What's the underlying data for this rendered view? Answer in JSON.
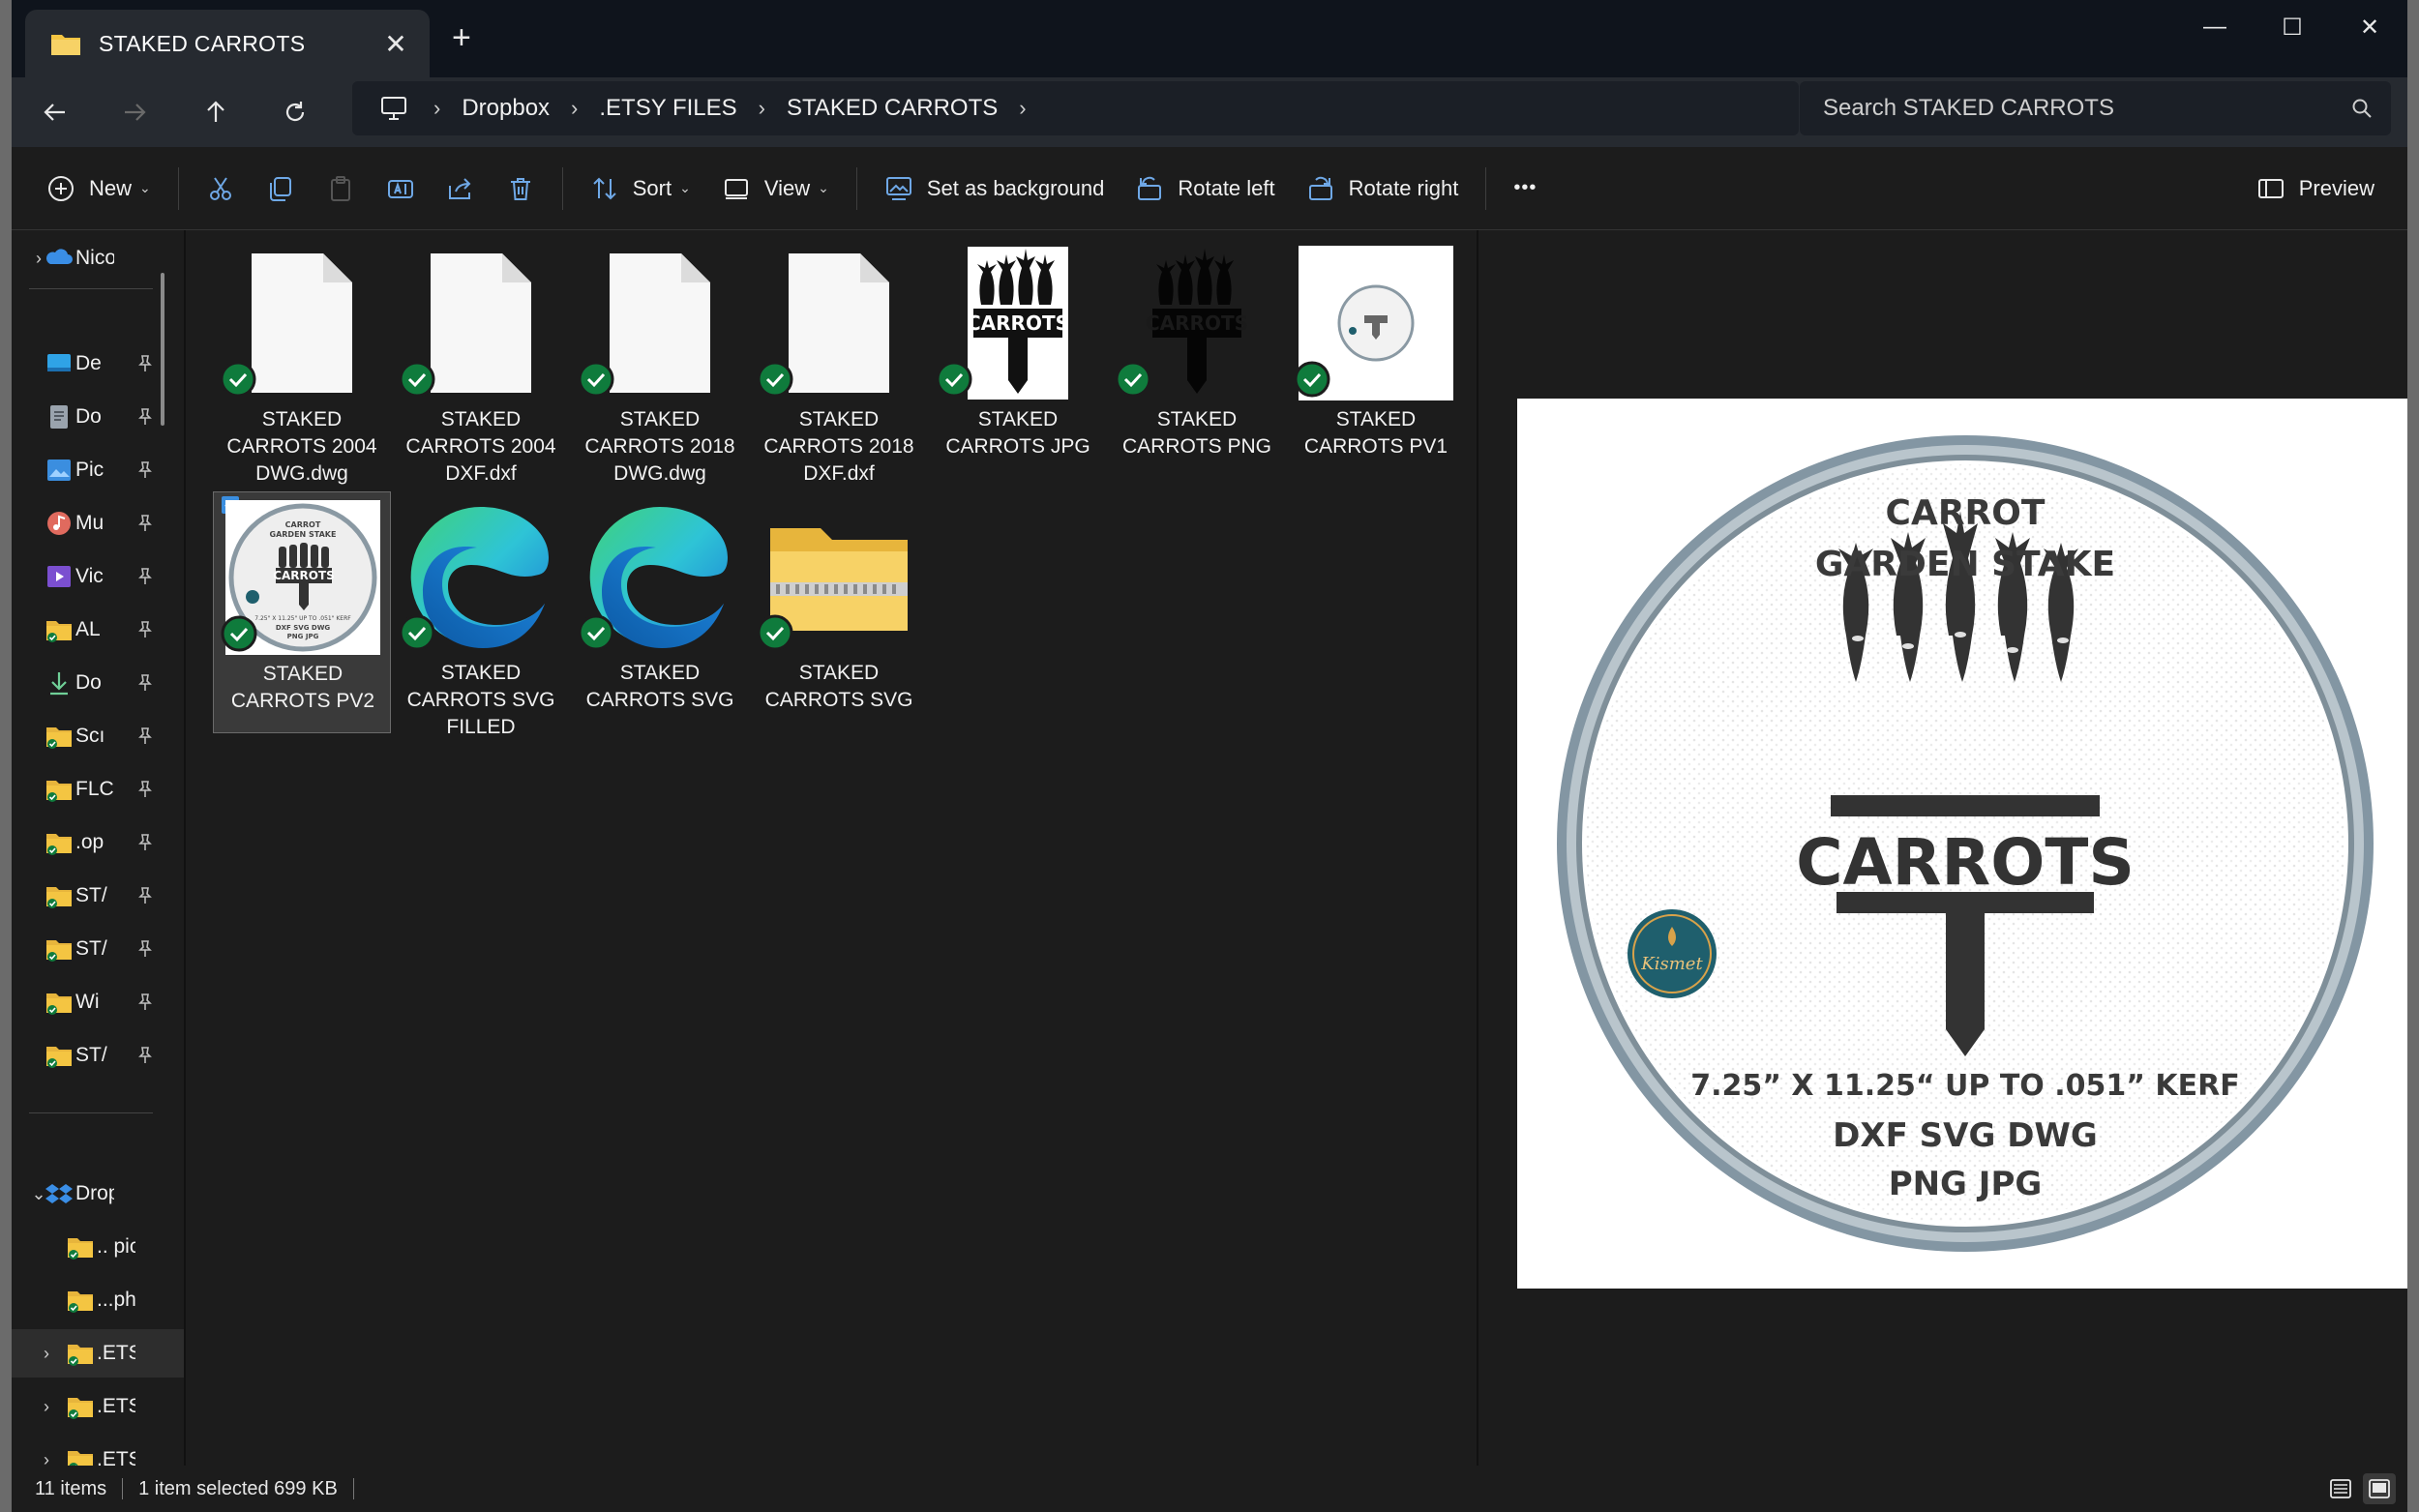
{
  "window": {
    "tab_title": "STAKED CARROTS",
    "close_tab": "✕",
    "new_tab": "+",
    "minimize": "—",
    "maximize": "☐",
    "close": "✕"
  },
  "address": {
    "crumbs": [
      "Dropbox",
      ".ETSY FILES",
      "STAKED CARROTS"
    ],
    "search_placeholder": "Search STAKED CARROTS"
  },
  "commands": {
    "new": "New",
    "sort": "Sort",
    "view": "View",
    "set_background": "Set as background",
    "rotate_left": "Rotate left",
    "rotate_right": "Rotate right",
    "more": "•••",
    "preview": "Preview"
  },
  "nav_pane": {
    "items": [
      {
        "label": "Nicole",
        "icon": "onedrive-icon",
        "expander": "›"
      },
      {
        "label": "De",
        "icon": "desktop-icon"
      },
      {
        "label": "Do",
        "icon": "documents-icon"
      },
      {
        "label": "Pic",
        "icon": "pictures-icon"
      },
      {
        "label": "Mu",
        "icon": "music-icon"
      },
      {
        "label": "Vic",
        "icon": "videos-icon"
      },
      {
        "label": "AL",
        "icon": "folder-icon"
      },
      {
        "label": "Do",
        "icon": "downloads-icon"
      },
      {
        "label": "Scı",
        "icon": "folder-icon"
      },
      {
        "label": "FLC",
        "icon": "folder-icon"
      },
      {
        "label": ".op",
        "icon": "folder-icon"
      },
      {
        "label": "ST/",
        "icon": "folder-icon"
      },
      {
        "label": "ST/",
        "icon": "folder-icon"
      },
      {
        "label": "Wi",
        "icon": "folder-icon"
      },
      {
        "label": "ST/",
        "icon": "folder-icon"
      },
      {
        "label": "Dropt",
        "icon": "dropbox-icon",
        "expander": "⌄"
      },
      {
        "label": ".. pic",
        "icon": "folder-icon"
      },
      {
        "label": "...ph",
        "icon": "folder-icon"
      },
      {
        "label": ".ETS",
        "icon": "folder-icon",
        "expander": "›"
      },
      {
        "label": ".ETS",
        "icon": "folder-icon",
        "expander": "›"
      },
      {
        "label": ".ETS",
        "icon": "folder-icon",
        "expander": "›"
      }
    ]
  },
  "files": [
    {
      "label": "STAKED CARROTS 2004 DWG.dwg",
      "type": "document"
    },
    {
      "label": "STAKED CARROTS 2004 DXF.dxf",
      "type": "document"
    },
    {
      "label": "STAKED CARROTS 2018 DWG.dwg",
      "type": "document"
    },
    {
      "label": "STAKED CARROTS 2018 DXF.dxf",
      "type": "document"
    },
    {
      "label": "STAKED CARROTS JPG",
      "type": "image-jpg"
    },
    {
      "label": "STAKED CARROTS PNG",
      "type": "image-png"
    },
    {
      "label": "STAKED CARROTS PV1",
      "type": "image-pv1"
    },
    {
      "label": "STAKED CARROTS PV2",
      "type": "image-pv2",
      "selected": true
    },
    {
      "label": "STAKED CARROTS SVG FILLED",
      "type": "edge"
    },
    {
      "label": "STAKED CARROTS SVG",
      "type": "edge"
    },
    {
      "label": "STAKED CARROTS SVG",
      "type": "zip"
    }
  ],
  "preview": {
    "line1": "CARROT",
    "line2": "GARDEN STAKE",
    "sign_word": "CARROTS",
    "dims": "7.25” X 11.25“ UP TO .051” KERF",
    "formats1": "DXF SVG DWG",
    "formats2": "PNG JPG",
    "logo_text": "Kismet"
  },
  "status": {
    "count": "11 items",
    "selection": "1 item selected  699 KB"
  },
  "colors": {
    "accent": "#3b8edf",
    "sync_green": "#0f7b3c",
    "folder_yellow": "#f4c542"
  }
}
